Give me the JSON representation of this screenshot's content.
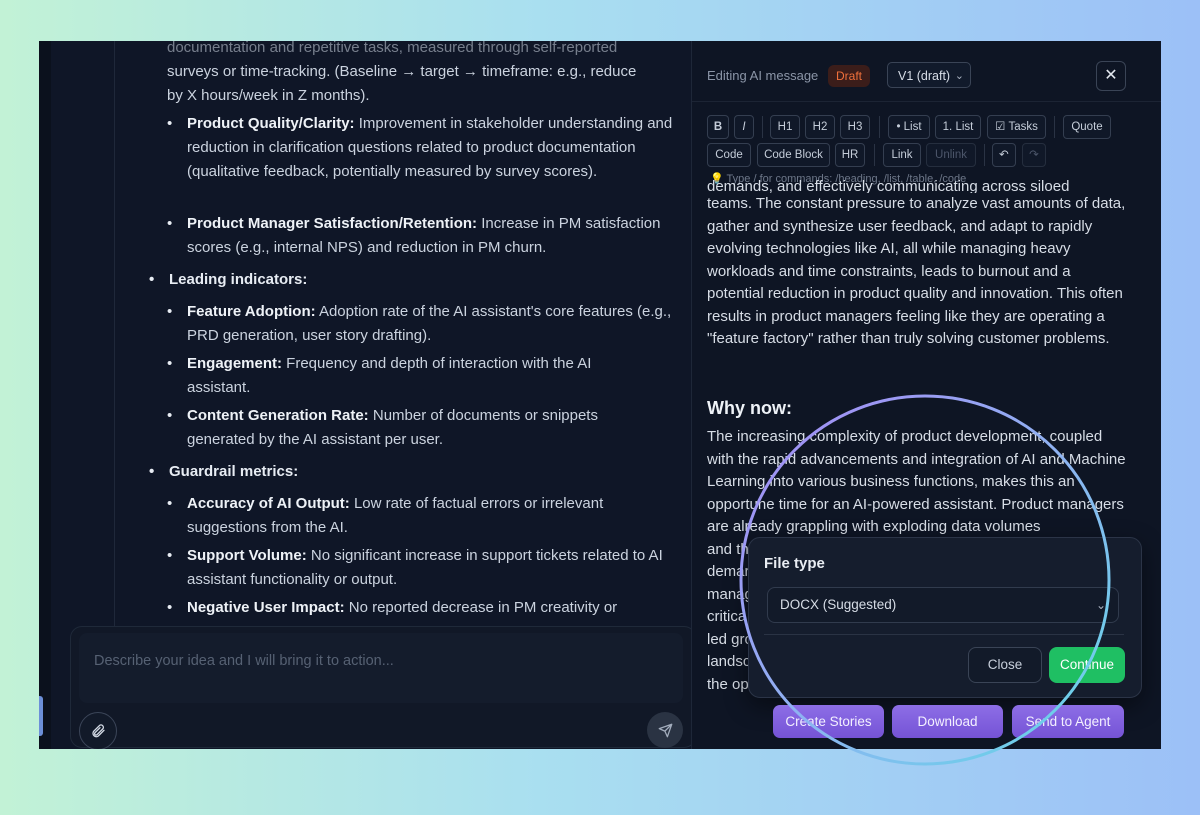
{
  "chat": {
    "top_fragment": "documentation and repetitive tasks, measured through self-reported",
    "top_line": "surveys or time-tracking. (Baseline → target → timeframe: e.g., reduce",
    "top_line2": "by X hours/week in Z months).",
    "items": [
      {
        "bold": "Product Quality/Clarity:",
        "text": " Improvement in stakeholder understanding and reduction in clarification questions related to product documentation (qualitative feedback, potentially measured by survey scores)."
      },
      {
        "bold": "Product Manager Satisfaction/Retention:",
        "text": " Increase in PM satisfaction scores (e.g., internal NPS) and reduction in PM churn."
      }
    ],
    "leading_heading": "Leading indicators:",
    "leading": [
      {
        "bold": "Feature Adoption:",
        "text": " Adoption rate of the AI assistant's core features (e.g., PRD generation, user story drafting)."
      },
      {
        "bold": "Engagement:",
        "text": " Frequency and depth of interaction with the AI assistant."
      },
      {
        "bold": "Content Generation Rate:",
        "text": " Number of documents or snippets generated by the AI assistant per user."
      }
    ],
    "guardrail_heading": "Guardrail metrics:",
    "guardrail": [
      {
        "bold": "Accuracy of AI Output:",
        "text": " Low rate of factual errors or irrelevant suggestions from the AI."
      },
      {
        "bold": "Support Volume:",
        "text": " No significant increase in support tickets related to AI assistant functionality or output."
      },
      {
        "bold": "Negative User Impact:",
        "text": " No reported decrease in PM creativity or"
      }
    ],
    "composer_placeholder": "Describe your idea and I will bring it to action...",
    "attach_icon": "paperclip-icon",
    "send_icon": "send-icon"
  },
  "editor": {
    "title": "Editing AI message",
    "badge": "Draft",
    "version": "V1 (draft)",
    "close": "✕",
    "toolbar": {
      "bold": "B",
      "italic": "I",
      "h1": "H1",
      "h2": "H2",
      "h3": "H3",
      "list": "• List",
      "olist": "1. List",
      "tasks": "☑ Tasks",
      "quote": "Quote",
      "code": "Code",
      "codeblock": "Code Block",
      "hr": "HR",
      "link": "Link",
      "unlink": "Unlink",
      "undo": "↶",
      "redo": "↷"
    },
    "hint": "💡 Type / for commands: /heading, /list, /table, /code",
    "body_cut": "demands, and effectively communicating across siloed",
    "body": "teams. The constant pressure to analyze vast amounts of data, gather and synthesize user feedback, and adapt to rapidly evolving technologies like AI, all while managing heavy workloads and time constraints, leads to burnout and a potential reduction in product quality and innovation. This often results in product managers feeling like they are operating a \"feature factory\" rather than truly solving customer problems.",
    "heading": "Why now:",
    "body2": "The increasing complexity of product development, coupled with the rapid advancements and integration of AI and Machine Learning into various business functions, makes this an opportune time for an AI-powered assistant. Product managers are already grappling with exploding data volumes",
    "partial_lines": [
      "and th",
      "demar",
      "manag",
      "critica",
      "led gro",
      "landsc",
      "the op"
    ]
  },
  "dialog": {
    "title": "File type",
    "select_value": "DOCX (Suggested)",
    "close_label": "Close",
    "continue_label": "Continue"
  },
  "actions": {
    "create_stories": "Create Stories",
    "download": "Download",
    "send_to_agent": "Send to Agent"
  }
}
